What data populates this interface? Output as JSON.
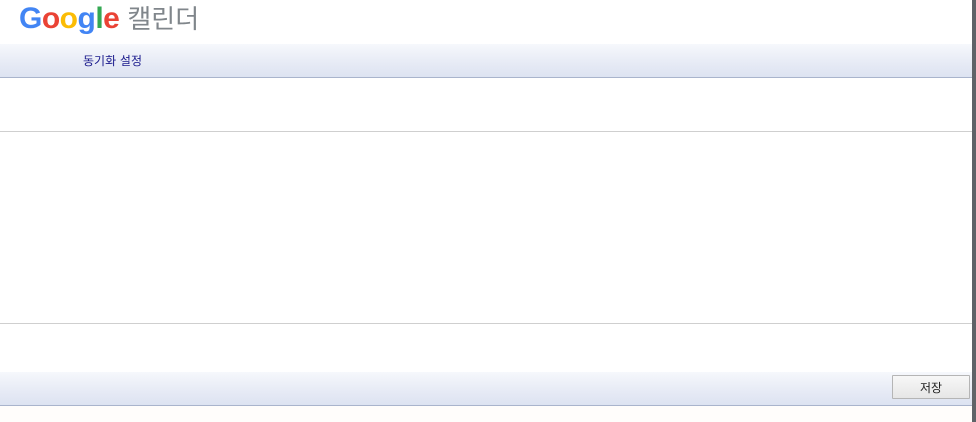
{
  "app": {
    "logo_letters": [
      {
        "char": "G",
        "color": "#4285F4"
      },
      {
        "char": "o",
        "color": "#EA4335"
      },
      {
        "char": "o",
        "color": "#FBBC05"
      },
      {
        "char": "g",
        "color": "#4285F4"
      },
      {
        "char": "l",
        "color": "#34A853"
      },
      {
        "char": "e",
        "color": "#EA4335"
      }
    ],
    "product_name": "캘린더"
  },
  "tabs": {
    "sync_settings_label": "동기화 설정"
  },
  "footer": {
    "save_label": "저장"
  },
  "colors": {
    "bar_gradient_top": "#f6f8fc",
    "bar_gradient_bottom": "#dde3f1",
    "link_color": "#1a1a8c",
    "product_text": "#80868b"
  }
}
